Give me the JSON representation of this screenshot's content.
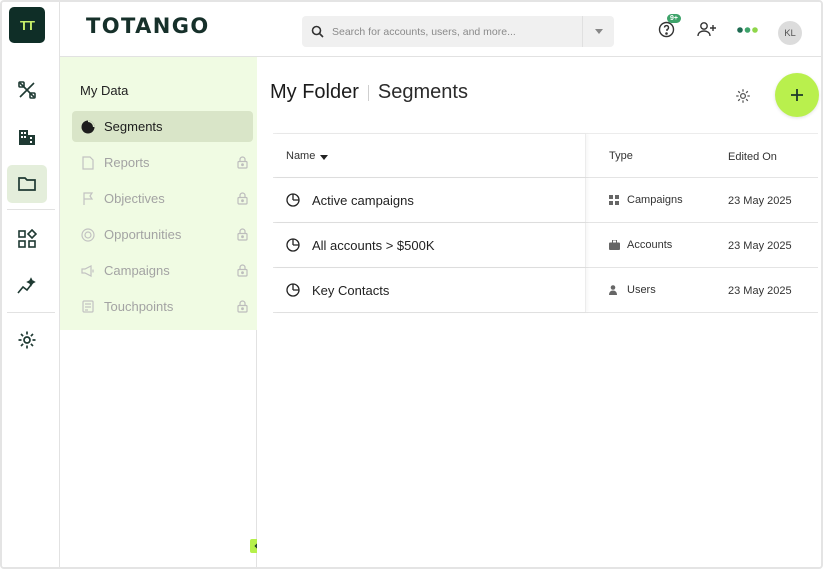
{
  "app": {
    "logo_mark": "TT",
    "brand": "TOTANGO",
    "accent": "#b9f04d",
    "dark": "#0f2e27"
  },
  "search": {
    "placeholder": "Search for accounts, users, and more..."
  },
  "topbar": {
    "help_badge": "9+",
    "avatar_initials": "KL"
  },
  "rail": {
    "items": [
      {
        "icon": "tools-icon"
      },
      {
        "icon": "buildings-icon"
      },
      {
        "icon": "folder-icon",
        "active": true
      },
      {
        "icon": "widgets-icon"
      },
      {
        "icon": "insights-icon"
      },
      {
        "icon": "gear-icon"
      }
    ]
  },
  "sidebar": {
    "title": "My Data",
    "items": [
      {
        "label": "Segments",
        "icon": "pie-icon",
        "active": true,
        "locked": false
      },
      {
        "label": "Reports",
        "icon": "report-icon",
        "locked": true
      },
      {
        "label": "Objectives",
        "icon": "flag-icon",
        "locked": true
      },
      {
        "label": "Opportunities",
        "icon": "target-icon",
        "locked": true
      },
      {
        "label": "Campaigns",
        "icon": "megaphone-icon",
        "locked": true
      },
      {
        "label": "Touchpoints",
        "icon": "note-icon",
        "locked": true
      }
    ]
  },
  "main": {
    "breadcrumb_parent": "My Folder",
    "breadcrumb_current": "Segments",
    "columns": [
      "Name",
      "Type",
      "Edited On"
    ],
    "rows": [
      {
        "name": "Active campaigns",
        "type": "Campaigns",
        "type_icon": "grid-icon",
        "edited": "23 May 2025"
      },
      {
        "name": "All accounts > $500K",
        "type": "Accounts",
        "type_icon": "briefcase-icon",
        "edited": "23 May 2025"
      },
      {
        "name": "Key Contacts",
        "type": "Users",
        "type_icon": "user-icon",
        "edited": "23 May 2025"
      }
    ]
  }
}
